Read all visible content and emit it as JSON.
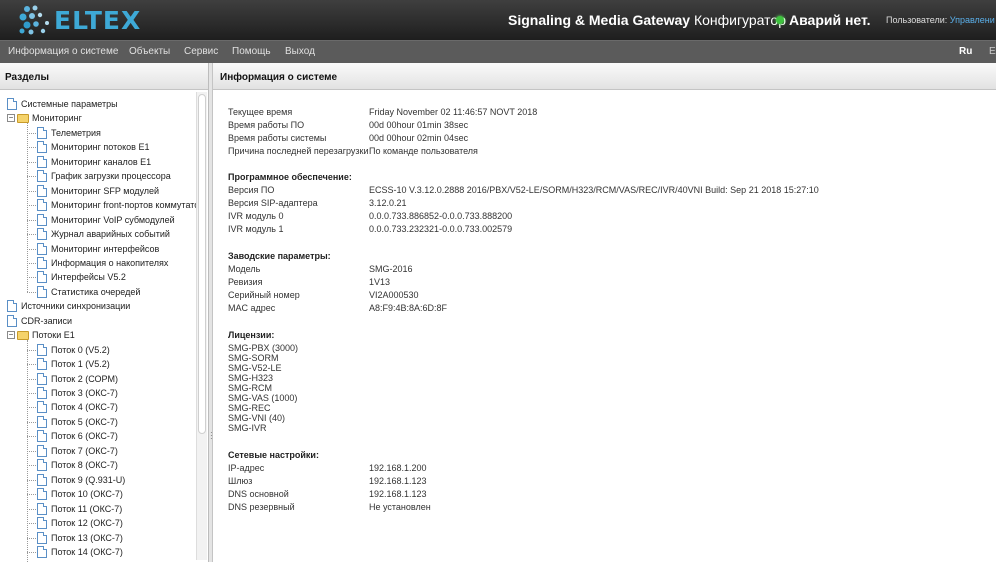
{
  "header": {
    "logo_text": "ELTEX",
    "product_bold": "Signaling & Media Gateway",
    "product_suffix": "Конфигуратор",
    "alarm_text": "Аварий нет.",
    "users_label": "Пользователи:",
    "users_link": "Управлени"
  },
  "menu": {
    "items": [
      "Информация о системе",
      "Объекты",
      "Сервис",
      "Помощь",
      "Выход"
    ],
    "lang_active": "Ru",
    "lang_other": "E"
  },
  "left_panel": {
    "title": "Разделы",
    "tree": [
      {
        "label": "Системные параметры",
        "type": "file",
        "level": 0
      },
      {
        "label": "Мониторинг",
        "type": "folder",
        "level": 0,
        "expanded": true
      },
      {
        "label": "Телеметрия",
        "type": "file",
        "level": 1
      },
      {
        "label": "Мониторинг потоков E1",
        "type": "file",
        "level": 1
      },
      {
        "label": "Мониторинг каналов E1",
        "type": "file",
        "level": 1
      },
      {
        "label": "График загрузки процессора",
        "type": "file",
        "level": 1
      },
      {
        "label": "Мониторинг SFP модулей",
        "type": "file",
        "level": 1
      },
      {
        "label": "Мониторинг front-портов коммутато",
        "type": "file",
        "level": 1
      },
      {
        "label": "Мониторинг VoIP субмодулей",
        "type": "file",
        "level": 1
      },
      {
        "label": "Журнал аварийных событий",
        "type": "file",
        "level": 1
      },
      {
        "label": "Мониторинг интерфейсов",
        "type": "file",
        "level": 1
      },
      {
        "label": "Информация о накопителях",
        "type": "file",
        "level": 1
      },
      {
        "label": "Интерфейсы V5.2",
        "type": "file",
        "level": 1
      },
      {
        "label": "Статистика очередей",
        "type": "file",
        "level": 1
      },
      {
        "label": "Источники синхронизации",
        "type": "file",
        "level": 0
      },
      {
        "label": "CDR-записи",
        "type": "file",
        "level": 0
      },
      {
        "label": "Потоки E1",
        "type": "folder",
        "level": 0,
        "expanded": true
      },
      {
        "label": "Поток 0 (V5.2)",
        "type": "file",
        "level": 1
      },
      {
        "label": "Поток 1 (V5.2)",
        "type": "file",
        "level": 1
      },
      {
        "label": "Поток 2 (СОРМ)",
        "type": "file",
        "level": 1
      },
      {
        "label": "Поток 3 (ОКС-7)",
        "type": "file",
        "level": 1
      },
      {
        "label": "Поток 4 (ОКС-7)",
        "type": "file",
        "level": 1
      },
      {
        "label": "Поток 5 (ОКС-7)",
        "type": "file",
        "level": 1
      },
      {
        "label": "Поток 6 (ОКС-7)",
        "type": "file",
        "level": 1
      },
      {
        "label": "Поток 7 (ОКС-7)",
        "type": "file",
        "level": 1
      },
      {
        "label": "Поток 8 (ОКС-7)",
        "type": "file",
        "level": 1
      },
      {
        "label": "Поток 9 (Q.931-U)",
        "type": "file",
        "level": 1
      },
      {
        "label": "Поток 10 (ОКС-7)",
        "type": "file",
        "level": 1
      },
      {
        "label": "Поток 11 (ОКС-7)",
        "type": "file",
        "level": 1
      },
      {
        "label": "Поток 12 (ОКС-7)",
        "type": "file",
        "level": 1
      },
      {
        "label": "Поток 13 (ОКС-7)",
        "type": "file",
        "level": 1
      },
      {
        "label": "Поток 14 (ОКС-7)",
        "type": "file",
        "level": 1
      }
    ]
  },
  "main": {
    "title": "Информация о системе",
    "time_info": [
      {
        "key": "Текущее время",
        "value": "Friday November 02 11:46:57 NOVT 2018"
      },
      {
        "key": "Время работы ПО",
        "value": "00d 00hour 01min 38sec"
      },
      {
        "key": "Время работы системы",
        "value": "00d 00hour 02min 04sec"
      },
      {
        "key": "Причина последней перезагрузки",
        "value": "По команде пользователя"
      }
    ],
    "software_title": "Программное обеспечение:",
    "software": [
      {
        "key": "Версия ПО",
        "value": "ECSS-10 V.3.12.0.2888 2016/PBX/V52-LE/SORM/H323/RCM/VAS/REC/IVR/40VNI Build: Sep 21 2018 15:27:10"
      },
      {
        "key": "Версия SIP-адаптера",
        "value": "3.12.0.21"
      },
      {
        "key": "IVR модуль 0",
        "value": "0.0.0.733.886852-0.0.0.733.888200"
      },
      {
        "key": "IVR модуль 1",
        "value": "0.0.0.733.232321-0.0.0.733.002579"
      }
    ],
    "factory_title": "Заводские параметры:",
    "factory": [
      {
        "key": "Модель",
        "value": "SMG-2016"
      },
      {
        "key": "Ревизия",
        "value": "1V13"
      },
      {
        "key": "Серийный номер",
        "value": "VI2A000530"
      },
      {
        "key": "MAC адрес",
        "value": "A8:F9:4B:8A:6D:8F"
      }
    ],
    "licenses_title": "Лицензии:",
    "licenses": [
      "SMG-PBX (3000)",
      "SMG-SORM",
      "SMG-V52-LE",
      "SMG-H323",
      "SMG-RCM",
      "SMG-VAS (1000)",
      "SMG-REC",
      "SMG-VNI (40)",
      "SMG-IVR"
    ],
    "network_title": "Сетевые настройки:",
    "network": [
      {
        "key": "IP-адрес",
        "value": "192.168.1.200"
      },
      {
        "key": "Шлюз",
        "value": "192.168.1.123"
      },
      {
        "key": "DNS основной",
        "value": "192.168.1.123"
      },
      {
        "key": "DNS резервный",
        "value": "Не установлен"
      }
    ]
  },
  "colors": {
    "header_bg": "#2a2a2a",
    "menubar_bg": "#5b5b5b",
    "logo": "#3ea9d6",
    "alarm_ok": "#3ec23e",
    "link": "#5aaee8"
  }
}
